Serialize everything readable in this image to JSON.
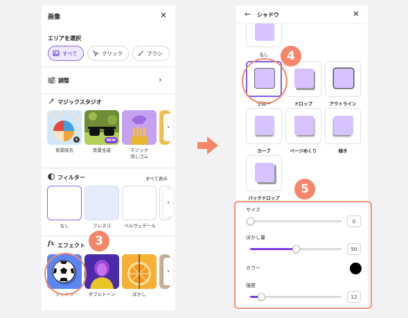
{
  "left_panel": {
    "title": "画像",
    "select_area": {
      "title": "エリアを選択",
      "pills": [
        {
          "label": "すべて",
          "active": true
        },
        {
          "label": "クリック",
          "active": false
        },
        {
          "label": "ブラシ",
          "active": false
        }
      ]
    },
    "adjust_label": "調整",
    "magic_studio": {
      "title": "マジックスタジオ",
      "items": [
        {
          "label": "背景除去"
        },
        {
          "label": "背景生成",
          "badge": "NEW"
        },
        {
          "label": "マジック\n消しゴム"
        }
      ]
    },
    "filter": {
      "title": "フィルター",
      "see_all": "すべて表示",
      "items": [
        {
          "label": "なし"
        },
        {
          "label": "フレスコ"
        },
        {
          "label": "ベルヴェデール"
        }
      ]
    },
    "effects": {
      "title": "エフェクト",
      "icon_text": "fx",
      "items": [
        {
          "label": "シャドウ"
        },
        {
          "label": "ダブルトーン"
        },
        {
          "label": "ぼかし"
        }
      ]
    }
  },
  "right_panel": {
    "title": "シャドウ",
    "top_item_label": "なし",
    "shadows": [
      {
        "label": "グロー",
        "selected": true
      },
      {
        "label": "ドロップ",
        "selected": false
      },
      {
        "label": "アウトライン",
        "selected": false
      },
      {
        "label": "カーブ",
        "selected": false
      },
      {
        "label": "ページめくり",
        "selected": false
      },
      {
        "label": "傾き",
        "selected": false
      },
      {
        "label": "バックドロップ",
        "selected": false
      }
    ],
    "settings": {
      "size": {
        "label": "サイズ",
        "value": "0",
        "fraction": 0.0
      },
      "blur": {
        "label": "ぼかし量",
        "value": "50",
        "fraction": 0.5
      },
      "color": {
        "label": "カラー",
        "value": "#000000"
      },
      "intensity": {
        "label": "強度",
        "value": "12",
        "fraction": 0.12
      }
    }
  },
  "callouts": {
    "step3": "3",
    "step4": "4",
    "step5": "5",
    "accent": "#f58669"
  }
}
